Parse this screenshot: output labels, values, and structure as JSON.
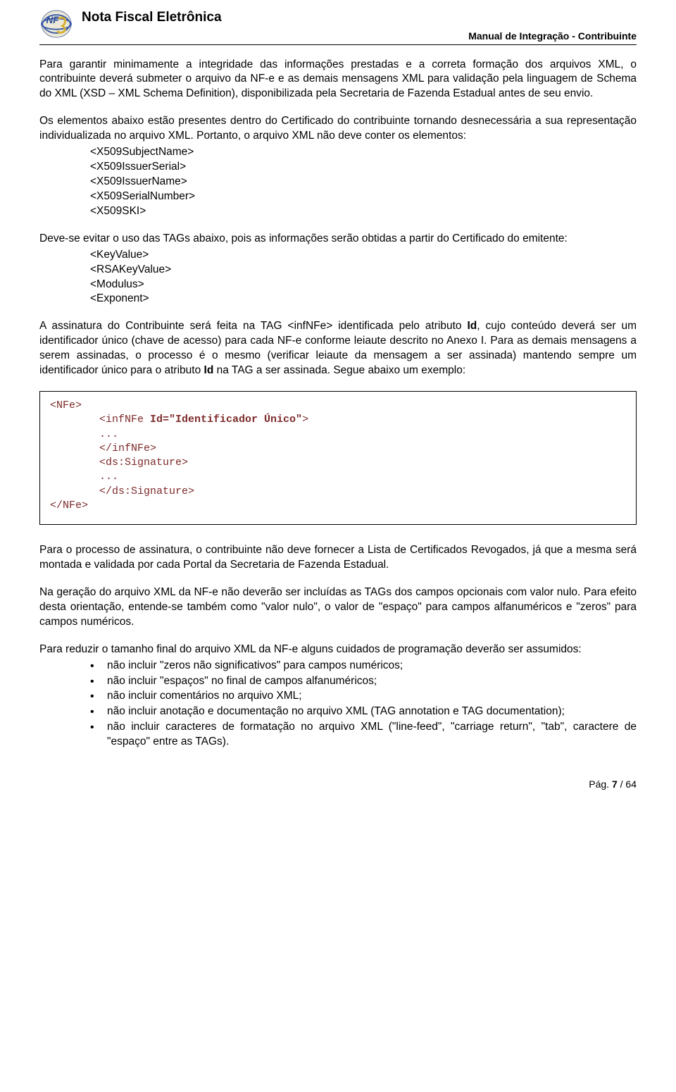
{
  "header": {
    "title": "Nota Fiscal Eletrônica",
    "subtitle": "Manual de Integração - Contribuinte"
  },
  "paragraphs": {
    "p1": "Para garantir minimamente a integridade das informações prestadas e a correta formação dos arquivos XML, o contribuinte deverá submeter o arquivo da NF-e e as demais mensagens XML para validação pela linguagem de Schema do XML (XSD – XML Schema Definition), disponibilizada pela Secretaria de Fazenda Estadual antes de seu envio.",
    "p2": "Os elementos abaixo estão presentes dentro do Certificado do contribuinte tornando desnecessária a sua representação individualizada no arquivo XML. Portanto, o arquivo XML não deve conter os elementos:",
    "p3": "Deve-se evitar o uso das TAGs abaixo, pois as informações serão obtidas a partir do Certificado do emitente:",
    "p4_pre": "A assinatura do Contribuinte será feita na TAG <infNFe> identificada pelo atributo ",
    "p4_bold": "Id",
    "p4_mid": ", cujo conteúdo deverá ser um identificador único (chave de acesso) para cada NF-e conforme leiaute descrito no Anexo I. Para as demais mensagens a serem assinadas, o processo é o mesmo (verificar leiaute da mensagem a ser assinada) mantendo sempre um identificador único para o atributo ",
    "p4_bold2": "Id",
    "p4_end": " na TAG a ser assinada. Segue abaixo um exemplo:",
    "p5": "Para o processo de assinatura, o contribuinte não deve fornecer a Lista de Certificados Revogados, já que a mesma será montada e validada por cada Portal da Secretaria de Fazenda Estadual.",
    "p6": "Na geração do arquivo XML da NF-e não deverão ser incluídas as TAGs dos campos opcionais com valor nulo. Para efeito desta orientação, entende-se também como \"valor nulo\", o valor de \"espaço\" para campos alfanuméricos e \"zeros\" para campos numéricos.",
    "p7": "Para reduzir o tamanho final do arquivo XML da NF-e alguns cuidados de programação deverão ser assumidos:"
  },
  "elements_block": {
    "e1": "<X509SubjectName>",
    "e2": "<X509IssuerSerial>",
    "e3": "<X509IssuerName>",
    "e4": "<X509SerialNumber>",
    "e5": "<X509SKI>"
  },
  "tags_block": {
    "t1": "<KeyValue>",
    "t2": "<RSAKeyValue>",
    "t3": "<Modulus>",
    "t4": "<Exponent>"
  },
  "code": {
    "open": "<NFe>",
    "l1a": "<infNFe ",
    "l1b": "Id=\"Identificador Único\"",
    "l1c": ">",
    "l2": "...",
    "l3": "</infNFe>",
    "l4": "<ds:Signature>",
    "l5": "...",
    "l6": "</ds:Signature>",
    "close": "</NFe>"
  },
  "bullets": {
    "b1": "não incluir \"zeros não significativos\" para campos numéricos;",
    "b2": "não incluir \"espaços\" no final de campos alfanuméricos;",
    "b3": "não incluir comentários no arquivo XML;",
    "b4": "não incluir anotação e documentação no arquivo XML (TAG annotation e TAG documentation);",
    "b5": "não incluir caracteres de formatação no arquivo XML (\"line-feed\", \"carriage return\", \"tab\", caractere de \"espaço\" entre as TAGs)."
  },
  "footer": {
    "label": "Pág. ",
    "page": "7",
    "sep": " / ",
    "total": "64"
  }
}
